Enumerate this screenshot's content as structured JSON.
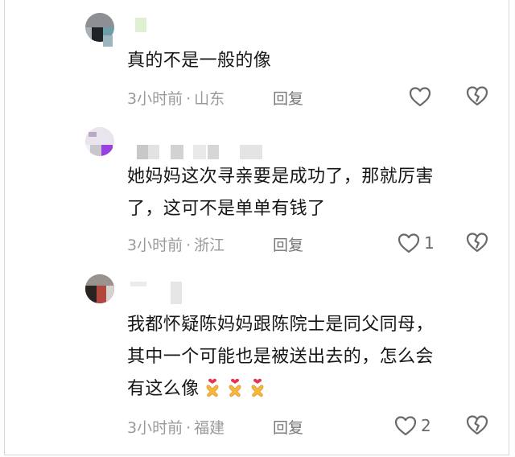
{
  "comments": [
    {
      "text": "真的不是一般的像",
      "time": "3小时前",
      "sep": "·",
      "location": "山东",
      "reply_label": "回复",
      "like_count": ""
    },
    {
      "text": "她妈妈这次寻亲要是成功了，那就厉害\n了，这可不是单单有钱了",
      "time": "3小时前",
      "sep": "·",
      "location": "浙江",
      "reply_label": "回复",
      "like_count": "1"
    },
    {
      "text": "我都怀疑陈妈妈跟陈院士是同父同母，\n其中一个可能也是被送出去的，怎么会\n有这么像",
      "time": "3小时前",
      "sep": "·",
      "location": "福建",
      "reply_label": "回复",
      "like_count": "2",
      "emoji_count": 3,
      "emoji_name": "heart-hands-emoji"
    }
  ],
  "colors": {
    "text": "#161616",
    "meta": "#9a9a9a",
    "icon": "#6a6a6a",
    "emoji_hand": "#f6b93b",
    "emoji_heart": "#e8344e"
  }
}
